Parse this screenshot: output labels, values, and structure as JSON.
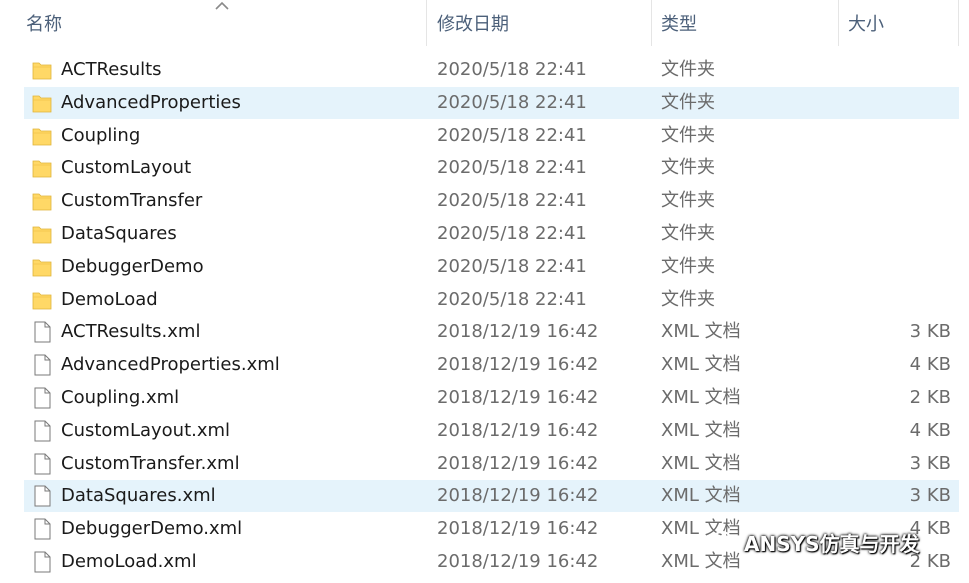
{
  "columns": {
    "name": "名称",
    "date": "修改日期",
    "type": "类型",
    "size": "大小"
  },
  "sort_icon": "chevron-up-icon",
  "files": [
    {
      "name": "ACTResults",
      "date": "2020/5/18 22:41",
      "type": "文件夹",
      "size": "",
      "kind": "folder",
      "selected": false
    },
    {
      "name": "AdvancedProperties",
      "date": "2020/5/18 22:41",
      "type": "文件夹",
      "size": "",
      "kind": "folder",
      "selected": true
    },
    {
      "name": "Coupling",
      "date": "2020/5/18 22:41",
      "type": "文件夹",
      "size": "",
      "kind": "folder",
      "selected": false
    },
    {
      "name": "CustomLayout",
      "date": "2020/5/18 22:41",
      "type": "文件夹",
      "size": "",
      "kind": "folder",
      "selected": false
    },
    {
      "name": "CustomTransfer",
      "date": "2020/5/18 22:41",
      "type": "文件夹",
      "size": "",
      "kind": "folder",
      "selected": false
    },
    {
      "name": "DataSquares",
      "date": "2020/5/18 22:41",
      "type": "文件夹",
      "size": "",
      "kind": "folder",
      "selected": false
    },
    {
      "name": "DebuggerDemo",
      "date": "2020/5/18 22:41",
      "type": "文件夹",
      "size": "",
      "kind": "folder",
      "selected": false
    },
    {
      "name": "DemoLoad",
      "date": "2020/5/18 22:41",
      "type": "文件夹",
      "size": "",
      "kind": "folder",
      "selected": false
    },
    {
      "name": "ACTResults.xml",
      "date": "2018/12/19 16:42",
      "type": "XML 文档",
      "size": "3 KB",
      "kind": "file",
      "selected": false
    },
    {
      "name": "AdvancedProperties.xml",
      "date": "2018/12/19 16:42",
      "type": "XML 文档",
      "size": "4 KB",
      "kind": "file",
      "selected": false
    },
    {
      "name": "Coupling.xml",
      "date": "2018/12/19 16:42",
      "type": "XML 文档",
      "size": "2 KB",
      "kind": "file",
      "selected": false
    },
    {
      "name": "CustomLayout.xml",
      "date": "2018/12/19 16:42",
      "type": "XML 文档",
      "size": "4 KB",
      "kind": "file",
      "selected": false
    },
    {
      "name": "CustomTransfer.xml",
      "date": "2018/12/19 16:42",
      "type": "XML 文档",
      "size": "3 KB",
      "kind": "file",
      "selected": false
    },
    {
      "name": "DataSquares.xml",
      "date": "2018/12/19 16:42",
      "type": "XML 文档",
      "size": "3 KB",
      "kind": "file",
      "selected": true
    },
    {
      "name": "DebuggerDemo.xml",
      "date": "2018/12/19 16:42",
      "type": "XML 文档",
      "size": "4 KB",
      "kind": "file",
      "selected": false
    },
    {
      "name": "DemoLoad.xml",
      "date": "2018/12/19 16:42",
      "type": "XML 文档",
      "size": "2 KB",
      "kind": "file",
      "selected": false
    }
  ],
  "icons": {
    "folder": "folder-icon",
    "file": "document-icon"
  },
  "colors": {
    "selection": "#e5f3fb",
    "folder": "#ffd866",
    "header_text": "#4c607a"
  },
  "watermark": {
    "text": "ANSYS仿真与开发",
    "icon": "wechat-icon"
  }
}
